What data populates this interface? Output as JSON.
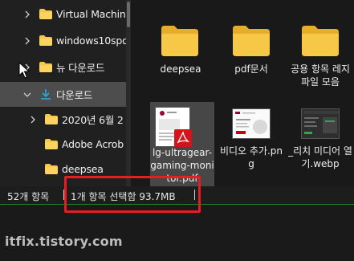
{
  "nav": {
    "items": [
      {
        "label": "Virtual Machin",
        "icon": "folder-icon"
      },
      {
        "label": "windows10spo",
        "icon": "folder-icon"
      },
      {
        "label": "뉴 다운로드",
        "icon": "folder-icon"
      },
      {
        "label": "다운로드",
        "icon": "download-icon",
        "selected": true
      },
      {
        "label": "2020년 6월 2",
        "icon": "folder-icon"
      },
      {
        "label": "Adobe Acrob",
        "icon": "folder-icon"
      },
      {
        "label": "deepsea",
        "icon": "folder-icon"
      }
    ]
  },
  "content": {
    "items": [
      {
        "label": "deepsea",
        "type": "folder"
      },
      {
        "label": "pdf문서",
        "type": "folder"
      },
      {
        "label": "공용 항목 레지파일 모음",
        "type": "folder"
      },
      {
        "label": "lg-ultragear-gaming-monitor.pdf",
        "type": "pdf",
        "selected": true
      },
      {
        "label": "비디오 추가.png",
        "type": "png"
      },
      {
        "label": "_리치 미디어 열기.webp",
        "type": "webp"
      }
    ]
  },
  "status": {
    "count": "52개 항목",
    "selected": "1개 항목 선택함 93.7MB"
  },
  "watermark": "itfix.tistory.com",
  "colors": {
    "folder": "#f7c748",
    "folder_dark": "#e6ad2a",
    "selection": "#4d4d4d",
    "highlight": "#e81c22",
    "download": "#2ea8d6",
    "pdf_red": "#d4141c"
  }
}
